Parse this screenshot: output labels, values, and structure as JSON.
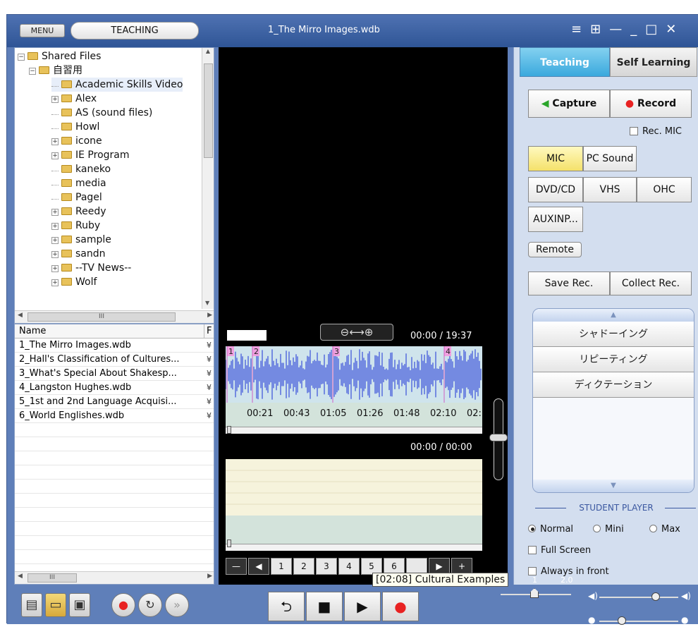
{
  "header": {
    "menu_label": "MENU",
    "mode_label": "TEACHING",
    "file_title": "1_The Mirro Images.wdb",
    "window_icons": [
      "≡",
      "⊞",
      "—",
      "_",
      "□",
      "✕"
    ]
  },
  "folder_tree": {
    "root": "Shared Files",
    "group": "自習用",
    "items": [
      {
        "label": "Academic Skills Video",
        "expandable": false,
        "selected": true
      },
      {
        "label": "Alex",
        "expandable": true
      },
      {
        "label": "AS (sound files)",
        "expandable": false
      },
      {
        "label": "Howl",
        "expandable": false
      },
      {
        "label": "icone",
        "expandable": true
      },
      {
        "label": "IE Program",
        "expandable": true
      },
      {
        "label": "kaneko",
        "expandable": false
      },
      {
        "label": "media",
        "expandable": false
      },
      {
        "label": "Pagel",
        "expandable": false
      },
      {
        "label": "Reedy",
        "expandable": true
      },
      {
        "label": "Ruby",
        "expandable": true
      },
      {
        "label": "sample",
        "expandable": true
      },
      {
        "label": "sandn",
        "expandable": true
      },
      {
        "label": "--TV News--",
        "expandable": true
      },
      {
        "label": "Wolf",
        "expandable": true
      }
    ],
    "scroll_thumb_text": "III"
  },
  "file_list": {
    "col_name": "Name",
    "col_second": "F",
    "rows": [
      {
        "name": "1_The Mirro Images.wdb",
        "col2": "¥"
      },
      {
        "name": "2_Hall's Classification of Cultures...",
        "col2": "¥"
      },
      {
        "name": "3_What's Special About Shakesp...",
        "col2": "¥"
      },
      {
        "name": "4_Langston Hughes.wdb",
        "col2": "¥"
      },
      {
        "name": "5_1st and 2nd Language Acquisi...",
        "col2": "¥"
      },
      {
        "name": "6_World Englishes.wdb",
        "col2": "¥"
      }
    ],
    "scroll_thumb_text": "III"
  },
  "player": {
    "top_time": "00:00 / 19:37",
    "bottom_time": "00:00 / 00:00",
    "zoom_label": "⊖⟷⊕",
    "ruler_ticks": [
      "00:21",
      "00:43",
      "01:05",
      "01:26",
      "01:48",
      "02:10",
      "02:"
    ],
    "markers": [
      "1",
      "2",
      "3",
      "4"
    ],
    "pager": [
      "—",
      "◀",
      "1",
      "2",
      "3",
      "4",
      "5",
      "6",
      "",
      "▶",
      "+"
    ]
  },
  "right_panel": {
    "tabs": [
      "Teaching",
      "Self Learning"
    ],
    "active_tab": "Teaching",
    "capture_label": "Capture",
    "record_label": "Record",
    "rec_mic_label": "Rec. MIC",
    "sources": [
      "MIC",
      "PC Sound",
      "DVD/CD",
      "VHS",
      "OHC",
      "AUXINP..."
    ],
    "active_source": "MIC",
    "remote_label": "Remote",
    "save_rec_label": "Save Rec.",
    "collect_rec_label": "Collect Rec.",
    "practice_items": [
      "シャドーイング",
      "リピーティング",
      "ディクテーション"
    ],
    "student_player_label": "STUDENT PLAYER",
    "size_options": [
      "Normal",
      "Mini",
      "Max"
    ],
    "selected_size": "Normal",
    "full_screen_label": "Full Screen",
    "always_front_label": "Always in front",
    "colors": {
      "accent": "#3aa9dd",
      "record": "#e82222",
      "capture": "#2aa52a"
    }
  },
  "bottom_bar": {
    "tooltip": "[02:08] Cultural Examples",
    "speed_min": "1",
    "speed_max": "2.0"
  }
}
